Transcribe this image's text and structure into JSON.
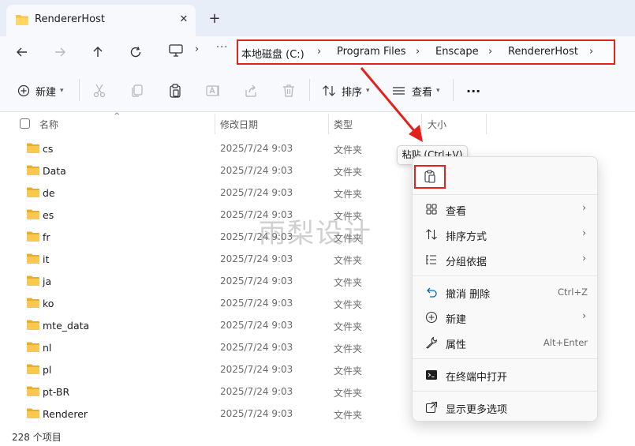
{
  "tab": {
    "title": "RendererHost",
    "close": "✕",
    "new": "+"
  },
  "nav": {
    "more": "···",
    "sep": "›"
  },
  "breadcrumbs": [
    "本地磁盘 (C:)",
    "Program Files",
    "Enscape",
    "RendererHost"
  ],
  "toolbar": {
    "new_label": "新建",
    "sort_label": "排序",
    "view_label": "查看",
    "more": "···"
  },
  "columns": {
    "name": "名称",
    "date": "修改日期",
    "type": "类型",
    "size": "大小"
  },
  "files": [
    {
      "name": "cs",
      "date": "2025/7/24 9:03",
      "type": "文件夹"
    },
    {
      "name": "Data",
      "date": "2025/7/24 9:03",
      "type": "文件夹"
    },
    {
      "name": "de",
      "date": "2025/7/24 9:03",
      "type": "文件夹"
    },
    {
      "name": "es",
      "date": "2025/7/24 9:03",
      "type": "文件夹"
    },
    {
      "name": "fr",
      "date": "2025/7/24 9:03",
      "type": "文件夹"
    },
    {
      "name": "it",
      "date": "2025/7/24 9:03",
      "type": "文件夹"
    },
    {
      "name": "ja",
      "date": "2025/7/24 9:03",
      "type": "文件夹"
    },
    {
      "name": "ko",
      "date": "2025/7/24 9:03",
      "type": "文件夹"
    },
    {
      "name": "mte_data",
      "date": "2025/7/24 9:03",
      "type": "文件夹"
    },
    {
      "name": "nl",
      "date": "2025/7/24 9:03",
      "type": "文件夹"
    },
    {
      "name": "pl",
      "date": "2025/7/24 9:03",
      "type": "文件夹"
    },
    {
      "name": "pt-BR",
      "date": "2025/7/24 9:03",
      "type": "文件夹"
    },
    {
      "name": "Renderer",
      "date": "2025/7/24 9:03",
      "type": "文件夹"
    }
  ],
  "status": "228 个项目",
  "tooltip": "粘贴 (Ctrl+V)",
  "context_menu": {
    "view": "查看",
    "sort": "排序方式",
    "group": "分组依据",
    "undo": "撤消 删除",
    "undo_shortcut": "Ctrl+Z",
    "new": "新建",
    "properties": "属性",
    "properties_shortcut": "Alt+Enter",
    "terminal": "在终端中打开",
    "more_options": "显示更多选项",
    "arrow": "›"
  },
  "watermark": "雨梨设计",
  "colors": {
    "highlight": "#e0231c",
    "folder": "#f5c24a",
    "accent": "#0067c0"
  }
}
